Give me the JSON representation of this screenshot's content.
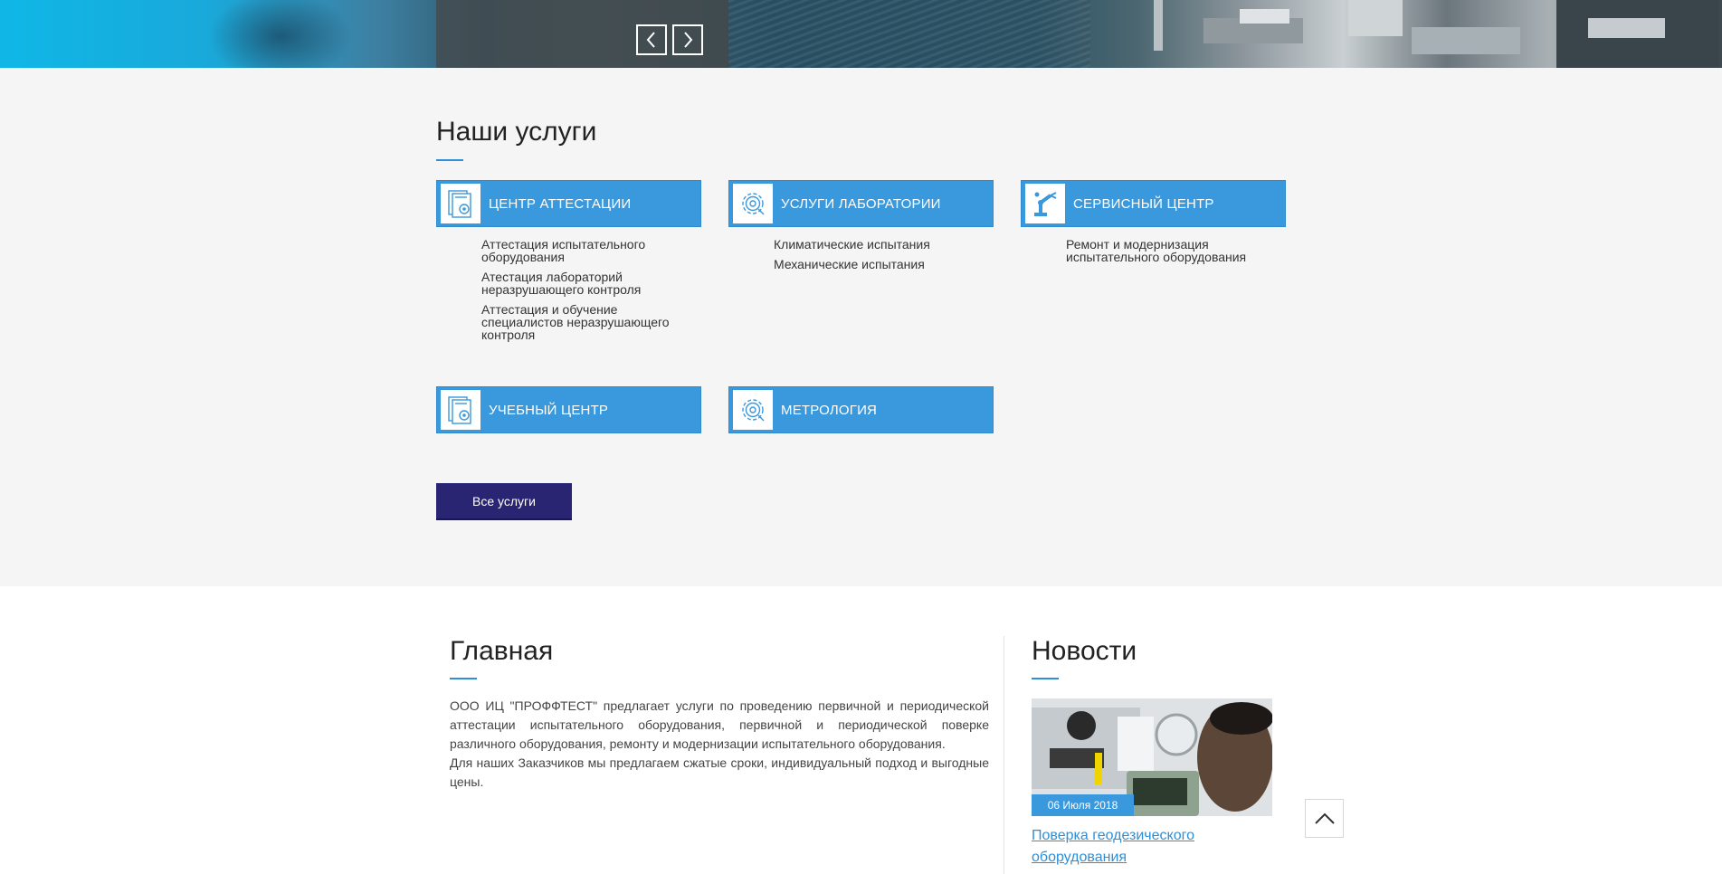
{
  "slider": {
    "prev_icon": "chevron-left-icon",
    "next_icon": "chevron-right-icon"
  },
  "services": {
    "title": "Наши услуги",
    "items": [
      {
        "label": "ЦЕНТР АТТЕСТАЦИИ",
        "icon": "document-gear-icon",
        "links": [
          "Аттестация испытательного оборудования",
          "Атестация лабораторий неразрушающего контроля",
          "Аттестация и обучение специалистов неразрушающего контроля"
        ]
      },
      {
        "label": "УСЛУГИ ЛАБОРАТОРИИ",
        "icon": "gear-icon",
        "links": [
          "Климатические испытания",
          "Механические испытания"
        ]
      },
      {
        "label": "СЕРВИСНЫЙ ЦЕНТР",
        "icon": "robot-arm-icon",
        "links": [
          "Ремонт и модернизация испытательного оборудования"
        ]
      },
      {
        "label": "УЧЕБНЫЙ ЦЕНТР",
        "icon": "document-gear-icon",
        "links": []
      },
      {
        "label": "МЕТРОЛОГИЯ",
        "icon": "gear-icon",
        "links": []
      }
    ],
    "all_button": "Все услуги"
  },
  "main": {
    "title": "Главная",
    "paragraphs": [
      "ООО ИЦ \"ПРОФФТЕСТ\" предлагает услуги по проведению первичной и периодической аттестации испытательного оборудования, первичной и периодической поверке различного оборудования, ремонту и модернизации испытательного оборудования.",
      "Для наших Заказчиков мы предлагаем сжатые сроки, индивидуальный подход и выгодные цены."
    ]
  },
  "news": {
    "title": "Новости",
    "items": [
      {
        "date": "06 Июля 2018",
        "title": "Поверка геодезического оборудования"
      }
    ]
  },
  "scroll_top_icon": "chevron-up-icon",
  "colors": {
    "accent": "#3a98dd",
    "button": "#2a2573",
    "section_bg": "#f5f5f5"
  }
}
